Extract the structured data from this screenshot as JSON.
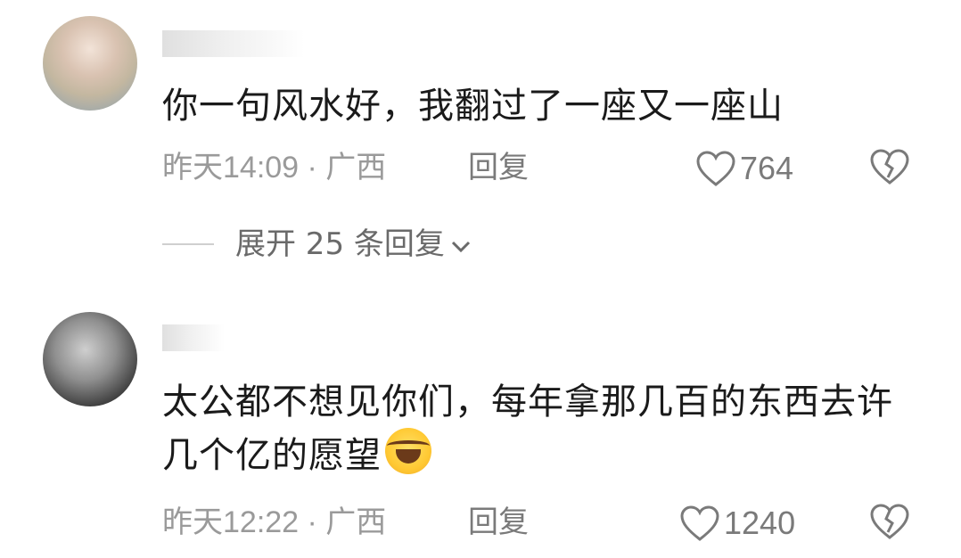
{
  "comments": [
    {
      "text": "你一句风水好，我翻过了一座又一座山",
      "time": "昨天14:09 · 广西",
      "reply_label": "回复",
      "likes": "764",
      "expand_replies": "展开 25 条回复"
    },
    {
      "text": "太公都不想见你们，每年拿那几百的东西去许几个亿的愿望",
      "emoji": "laughing-crying-emoji",
      "time": "昨天12:22 · 广西",
      "reply_label": "回复",
      "likes": "1240"
    }
  ],
  "icons": [
    "heart-icon",
    "heartbreak-icon",
    "chevron-down-icon"
  ],
  "colors": {
    "text": "#1a1a1a",
    "meta": "#9a9a9a",
    "action": "#7a7a7a"
  }
}
